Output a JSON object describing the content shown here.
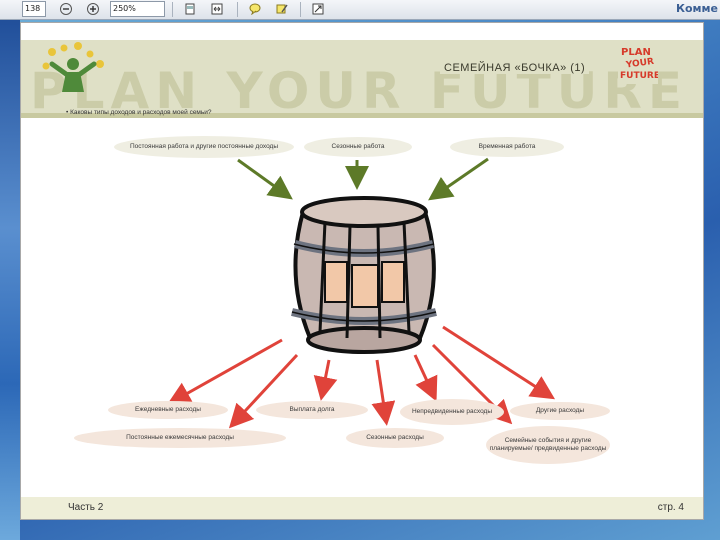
{
  "toolbar": {
    "page_number": "138",
    "zoom": "250%",
    "right_label": "Комме"
  },
  "page": {
    "section_title": "СЕМЕЙНАЯ «БОЧКА» (1)",
    "question": "• Каковы типы доходов и расходов моей семьи?",
    "logo_lines": [
      "PLAN",
      "YOUR",
      "FUTURE"
    ],
    "income": [
      "Постоянная работа и другие постоянные доходы",
      "Сезонные работа",
      "Временная работа"
    ],
    "expenses": [
      "Ежедневные расходы",
      "Постоянные ежемесячные расходы",
      "Выплата долга",
      "Сезонные расходы",
      "Непредвиденные расходы",
      "Другие расходы",
      "Семейные события и другие планируемые/ предвиденные расходы"
    ],
    "footer_left": "Часть 2",
    "footer_right": "стр. 4"
  },
  "colors": {
    "income_arrow": "#5d7a28",
    "expense_arrow": "#e0433a",
    "banner": "#dfe0c6",
    "slide_blue": "#2f5ea8"
  }
}
